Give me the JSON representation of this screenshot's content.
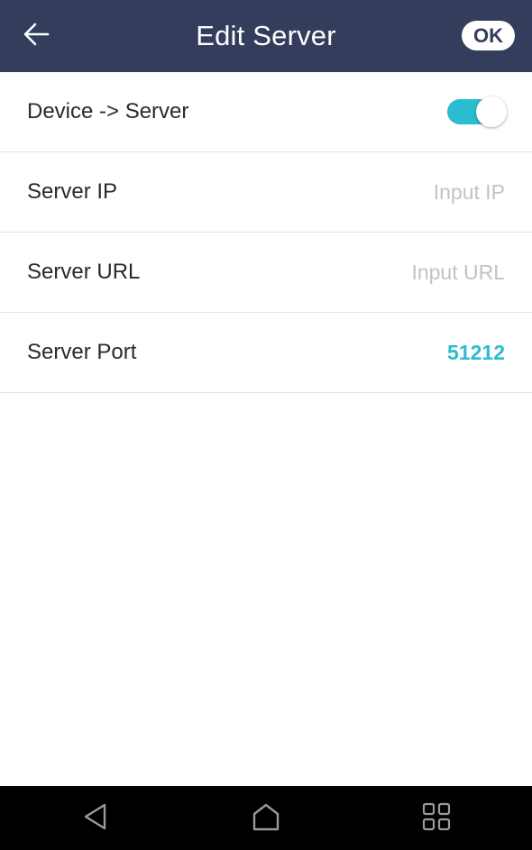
{
  "header": {
    "title": "Edit Server",
    "ok_label": "OK",
    "back_icon": "arrow-left-icon"
  },
  "rows": [
    {
      "label": "Device -> Server",
      "type": "toggle",
      "enabled": true
    },
    {
      "label": "Server IP",
      "type": "input",
      "value": "",
      "placeholder": "Input IP"
    },
    {
      "label": "Server URL",
      "type": "input",
      "value": "",
      "placeholder": "Input URL"
    },
    {
      "label": "Server Port",
      "type": "value",
      "value": "51212"
    }
  ],
  "navbar": {
    "icons": [
      "back-triangle-icon",
      "home-icon",
      "recents-grid-icon"
    ]
  },
  "colors": {
    "header_bg": "#343d5c",
    "accent": "#2bbcd0",
    "navbar_bg": "#000000",
    "placeholder": "#c3c3c3"
  }
}
